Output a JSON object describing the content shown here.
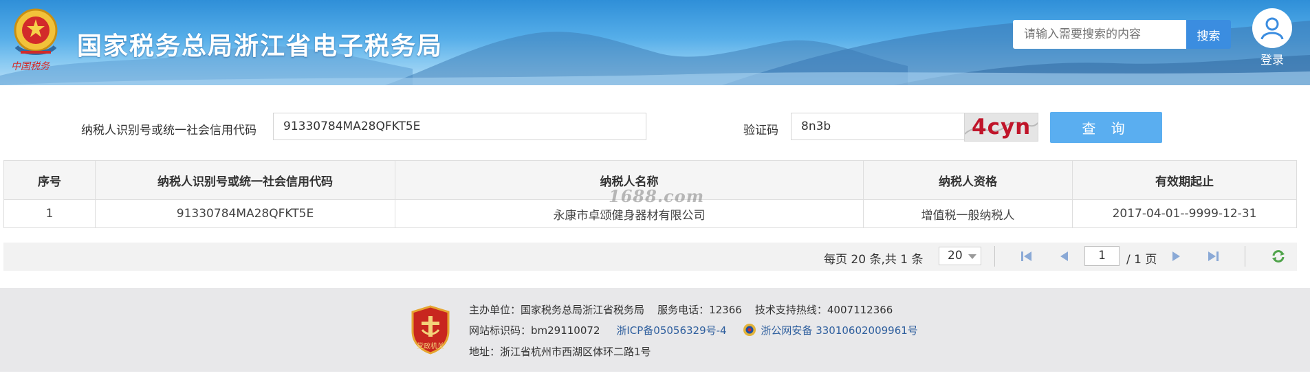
{
  "header": {
    "site_title": "国家税务总局浙江省电子税务局",
    "search_placeholder": "请输入需要搜索的内容",
    "search_button": "搜索",
    "login_label": "登录",
    "emblem_text": "中国税务"
  },
  "query": {
    "taxpayer_id_label": "纳税人识别号或统一社会信用代码",
    "taxpayer_id_value": "91330784MA28QFKT5E",
    "captcha_label": "验证码",
    "captcha_value": "8n3b",
    "captcha_image_text": "4cyn",
    "query_button": "查 询"
  },
  "table": {
    "headers": [
      "序号",
      "纳税人识别号或统一社会信用代码",
      "纳税人名称",
      "纳税人资格",
      "有效期起止"
    ],
    "rows": [
      [
        "1",
        "91330784MA28QFKT5E",
        "永康市卓颂健身器材有限公司",
        "增值税一般纳税人",
        "2017-04-01--9999-12-31"
      ]
    ]
  },
  "watermark": "1688.com",
  "pager": {
    "summary": "每页 20 条,共 1 条",
    "page_size": "20",
    "current_page": "1",
    "total_pages": "/ 1 页"
  },
  "footer": {
    "sponsor": "主办单位：国家税务总局浙江省税务局",
    "service_phone": "服务电话：12366",
    "tech_support": "技术支持热线：4007112366",
    "site_id": "网站标识码：bm29110072",
    "icp": "浙ICP备05056329号-4",
    "police_record": "浙公网安备 33010602009961号",
    "address": "地址：浙江省杭州市西湖区体环二路1号",
    "badge_text": "党政机关"
  },
  "colors": {
    "header_blue": "#2f8fd8",
    "search_button": "#3b8de0",
    "query_button": "#5aaef0",
    "captcha_red": "#c0152a",
    "footer_bg": "#e8e8ea",
    "link_blue": "#2f5f9e"
  },
  "icons": [
    "national-emblem-icon",
    "user-icon",
    "first-page-icon",
    "prev-page-icon",
    "next-page-icon",
    "last-page-icon",
    "refresh-icon",
    "police-badge-icon",
    "party-government-badge-icon"
  ]
}
